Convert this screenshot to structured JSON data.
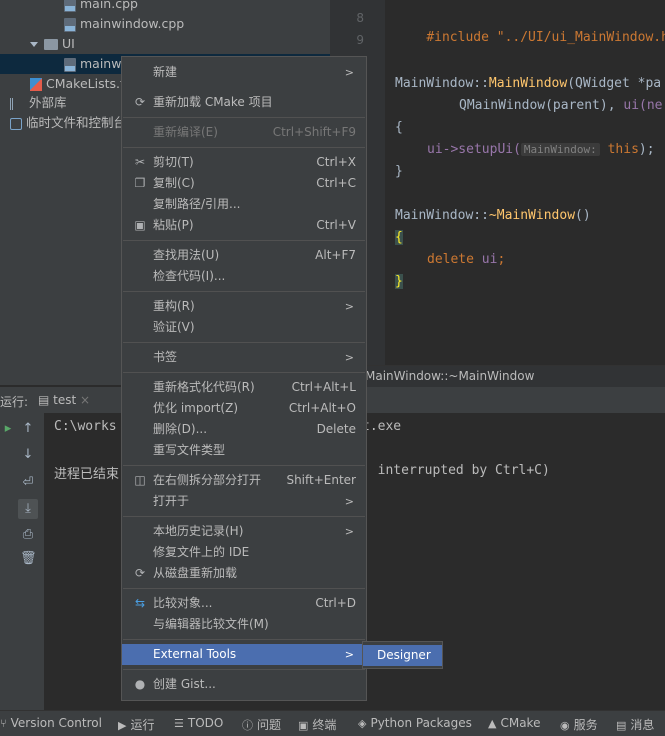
{
  "project_tree": {
    "items": [
      {
        "label": "main.cpp"
      },
      {
        "label": "mainwindow.cpp"
      },
      {
        "label": "UI"
      },
      {
        "label": "mainw"
      },
      {
        "label": "CMakeLists.t"
      },
      {
        "label": "外部库"
      },
      {
        "label": "临时文件和控制台"
      }
    ]
  },
  "editor": {
    "line_numbers": [
      "8",
      "9"
    ],
    "lines": [
      {
        "text": "#include \"../UI/ui_MainWindow.h\""
      },
      {
        "a": "MainWindow::",
        "b": "MainWindow",
        "c": "(QWidget *pa"
      },
      {
        "a": "QMainWindow(parent), ",
        "b": "ui(ne"
      },
      {
        "text": "{"
      },
      {
        "a": "ui->setupUi(",
        "hint": "MainWindow:",
        "b": "this",
        "c": ");"
      },
      {
        "text": "}"
      },
      {
        "a": "MainWindow::",
        "b": "~MainWindow",
        "c": "()"
      },
      {
        "text": "{"
      },
      {
        "a": "delete ",
        "b": "ui",
        "c": ";"
      },
      {
        "text": "}"
      }
    ],
    "breadcrumb": "MainWindow::~MainWindow"
  },
  "run_panel": {
    "label": "运行:",
    "tab": "test",
    "console_lines": [
      {
        "left": "C:\\works",
        "right": "t.exe"
      },
      {
        "left": "进程已结束",
        "right": ": interrupted by Ctrl+C)"
      }
    ]
  },
  "status_bar": {
    "items": [
      {
        "label": "Version Control",
        "icon": "branch-icon"
      },
      {
        "label": "运行",
        "icon": "run-icon"
      },
      {
        "label": "TODO",
        "icon": "list-icon"
      },
      {
        "label": "问题",
        "icon": "problems-icon"
      },
      {
        "label": "终端",
        "icon": "terminal-icon"
      },
      {
        "label": "Python Packages",
        "icon": "packages-icon"
      },
      {
        "label": "CMake",
        "icon": "cmake-icon"
      },
      {
        "label": "服务",
        "icon": "services-icon"
      },
      {
        "label": "消息",
        "icon": "messages-icon"
      }
    ]
  },
  "context_menu": {
    "items": [
      {
        "label": "新建",
        "submenu": true
      },
      {
        "label": "重新加载 CMake 项目",
        "icon": "reload-icon"
      },
      {
        "label": "重新编译(E)",
        "shortcut": "Ctrl+Shift+F9",
        "disabled": true
      },
      {
        "label": "剪切(T)",
        "shortcut": "Ctrl+X",
        "icon": "scissors-icon"
      },
      {
        "label": "复制(C)",
        "shortcut": "Ctrl+C",
        "icon": "copy-icon"
      },
      {
        "label": "复制路径/引用..."
      },
      {
        "label": "粘贴(P)",
        "shortcut": "Ctrl+V",
        "icon": "paste-icon"
      },
      {
        "label": "查找用法(U)",
        "shortcut": "Alt+F7"
      },
      {
        "label": "检查代码(I)..."
      },
      {
        "label": "重构(R)",
        "submenu": true
      },
      {
        "label": "验证(V)"
      },
      {
        "label": "书签",
        "submenu": true
      },
      {
        "label": "重新格式化代码(R)",
        "shortcut": "Ctrl+Alt+L"
      },
      {
        "label": "优化 import(Z)",
        "shortcut": "Ctrl+Alt+O"
      },
      {
        "label": "删除(D)...",
        "shortcut": "Delete"
      },
      {
        "label": "重写文件类型"
      },
      {
        "label": "在右侧拆分部分打开",
        "shortcut": "Shift+Enter",
        "icon": "split-icon"
      },
      {
        "label": "打开于",
        "submenu": true
      },
      {
        "label": "本地历史记录(H)",
        "submenu": true
      },
      {
        "label": "修复文件上的 IDE"
      },
      {
        "label": "从磁盘重新加载",
        "icon": "reload-icon"
      },
      {
        "label": "比较对象...",
        "shortcut": "Ctrl+D",
        "icon": "compare-icon"
      },
      {
        "label": "与编辑器比较文件(M)"
      },
      {
        "label": "External Tools",
        "submenu": true,
        "selected": true
      },
      {
        "label": "创建 Gist...",
        "icon": "github-icon"
      }
    ]
  },
  "submenu": {
    "items": [
      {
        "label": "Designer"
      }
    ]
  }
}
